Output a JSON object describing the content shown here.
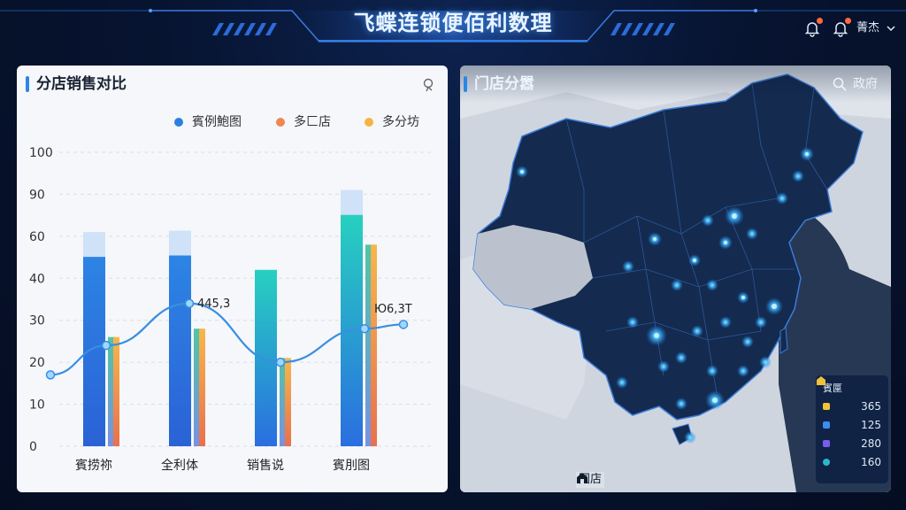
{
  "header": {
    "title": "飞蝶连锁便佰利数理",
    "user_name": "菁杰",
    "notification_dot_color": "#ff6a3d",
    "icons": [
      "bell-icon",
      "alarm-bell-icon",
      "chevron-down-icon"
    ]
  },
  "sales_panel": {
    "title": "分店销售对比",
    "tool_icon": "settings-loop-icon",
    "legend": [
      {
        "label": "賓例鮑图",
        "color": "#2b7fe0"
      },
      {
        "label": "多匚店",
        "color": "#f0874f"
      },
      {
        "label": "多分坊",
        "color": "#f5b443"
      }
    ]
  },
  "chart_data": {
    "type": "bar",
    "title": "分店销售对比",
    "categories": [
      "賓捞祢",
      "全利体",
      "销售说",
      "賓刖图"
    ],
    "y_tick_labels": [
      "0",
      "10",
      "20",
      "30",
      "40",
      "60",
      "90",
      "100"
    ],
    "ylim": [
      0,
      100
    ],
    "series": [
      {
        "name": "賓例鮑图",
        "values": [
          63,
          64,
          44,
          91
        ]
      },
      {
        "name": "多匚店",
        "values": [
          26,
          28,
          21,
          56
        ]
      },
      {
        "name": "多分坊",
        "values": [
          26,
          28,
          21,
          56
        ]
      }
    ],
    "line_series": [
      17,
      24,
      34,
      20,
      28,
      29
    ],
    "annotations": [
      "445,3",
      "Ю6,3T"
    ],
    "grid": true,
    "legend_position": "top"
  },
  "map_panel": {
    "title": "门店分嚣",
    "search_label": "政府",
    "search_icon": "search-icon",
    "caption": "国店",
    "caption_icon": "store-icon",
    "legend": {
      "title": "賓匰",
      "rows": [
        {
          "value": "365",
          "color": "#f0c23a"
        },
        {
          "value": "125",
          "color": "#3d8cf0"
        },
        {
          "value": "280",
          "color": "#7a5cf0"
        },
        {
          "value": "160",
          "color": "#2fb5c9"
        }
      ]
    }
  }
}
